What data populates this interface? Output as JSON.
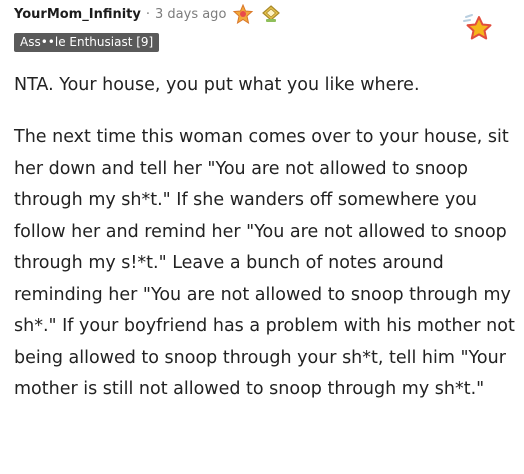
{
  "comment": {
    "author": "YourMom_Infinity",
    "separator": "·",
    "timestamp": "3 days ago",
    "awards": [
      {
        "icon": "rocket-like-award-icon",
        "color": "#f2a93b"
      },
      {
        "icon": "hat-award-icon",
        "color": "#e8c24a"
      }
    ],
    "side_award": {
      "icon": "star-award-icon",
      "color": "#f5b61b",
      "outline": "#e14d3d"
    },
    "flair": "Ass••le Enthusiast [9]",
    "paragraphs": [
      "NTA. Your house, you put what you like where.",
      "The next time this woman comes over to your house, sit her down and tell her \"You are not allowed to snoop through my sh*t.\" If she wanders off somewhere you follow her and remind her \"You are not allowed to snoop through my s!*t.\" Leave a bunch of notes around reminding her \"You are not allowed to snoop through my sh*.\" If your boyfriend has a problem with his mother not being allowed to snoop through your sh*t, tell him \"Your mother is still not allowed to snoop through my sh*t.\""
    ]
  }
}
